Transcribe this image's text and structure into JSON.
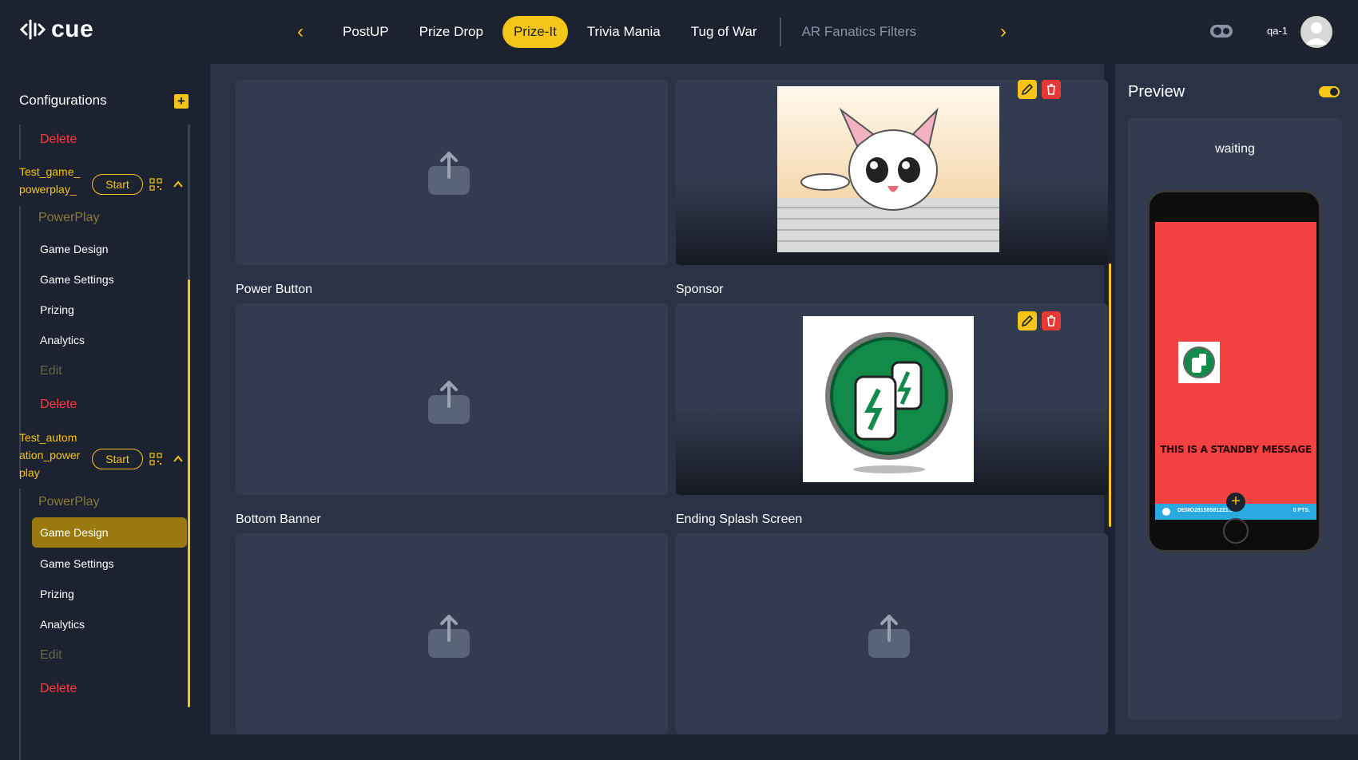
{
  "app": {
    "logo_text": "cue"
  },
  "nav": {
    "tabs": [
      {
        "label": "PostUP"
      },
      {
        "label": "Prize Drop"
      },
      {
        "label": "Prize-It"
      },
      {
        "label": "Trivia Mania"
      },
      {
        "label": "Tug of War"
      },
      {
        "label": "AR Fanatics Filters"
      }
    ],
    "active_tab": "Prize-It"
  },
  "user": {
    "name": "qa-1"
  },
  "sidebar": {
    "title": "Configurations",
    "top_delete": "Delete",
    "games": [
      {
        "name": "Test_game_ powerplay_",
        "start_label": "Start",
        "type_label": "PowerPlay",
        "items": [
          "Game Design",
          "Game Settings",
          "Prizing",
          "Analytics"
        ],
        "edit_label": "Edit",
        "delete_label": "Delete"
      },
      {
        "name": "Test_autom ation_power play",
        "start_label": "Start",
        "type_label": "PowerPlay",
        "items": [
          "Game Design",
          "Game Settings",
          "Prizing",
          "Analytics"
        ],
        "active_item": "Game Design",
        "edit_label": "Edit",
        "delete_label": "Delete"
      }
    ]
  },
  "gallery": {
    "cards": [
      {
        "label": "Power Button"
      },
      {
        "label": "Sponsor"
      },
      {
        "label": "Bottom Banner"
      },
      {
        "label": "Ending Splash Screen"
      }
    ]
  },
  "preview": {
    "title": "Preview",
    "status": "waiting",
    "standby_message": "THIS IS A STANDBY MESSAGE",
    "bar_left": "DEMO28158581221...",
    "bar_right": "0 PTS."
  },
  "colors": {
    "accent": "#f5c518",
    "danger": "#ff3b3b",
    "background": "#1c2230",
    "panel": "#2a3345"
  }
}
